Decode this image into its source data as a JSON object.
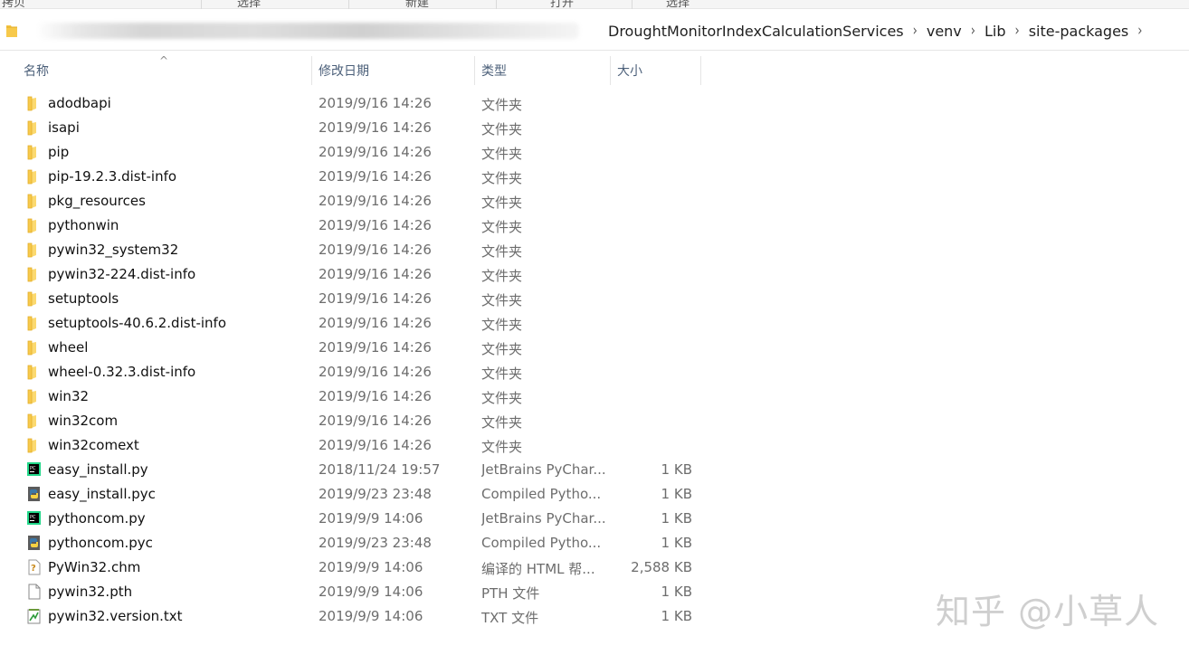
{
  "ribbon": {
    "labels": [
      "拷贝",
      "选择",
      "新建",
      "打开",
      "选择"
    ]
  },
  "address": {
    "crumbs": [
      "DroughtMonitorIndexCalculationServices",
      "venv",
      "Lib",
      "site-packages"
    ]
  },
  "columns": {
    "name": "名称",
    "date": "修改日期",
    "type": "类型",
    "size": "大小",
    "sort_indicator": "^"
  },
  "files": [
    {
      "icon": "folder-icon",
      "name": "adodbapi",
      "date": "2019/9/16 14:26",
      "type": "文件夹",
      "size": ""
    },
    {
      "icon": "folder-icon",
      "name": "isapi",
      "date": "2019/9/16 14:26",
      "type": "文件夹",
      "size": ""
    },
    {
      "icon": "folder-icon",
      "name": "pip",
      "date": "2019/9/16 14:26",
      "type": "文件夹",
      "size": ""
    },
    {
      "icon": "folder-icon",
      "name": "pip-19.2.3.dist-info",
      "date": "2019/9/16 14:26",
      "type": "文件夹",
      "size": ""
    },
    {
      "icon": "folder-icon",
      "name": "pkg_resources",
      "date": "2019/9/16 14:26",
      "type": "文件夹",
      "size": ""
    },
    {
      "icon": "folder-icon",
      "name": "pythonwin",
      "date": "2019/9/16 14:26",
      "type": "文件夹",
      "size": ""
    },
    {
      "icon": "folder-icon",
      "name": "pywin32_system32",
      "date": "2019/9/16 14:26",
      "type": "文件夹",
      "size": ""
    },
    {
      "icon": "folder-icon",
      "name": "pywin32-224.dist-info",
      "date": "2019/9/16 14:26",
      "type": "文件夹",
      "size": ""
    },
    {
      "icon": "folder-icon",
      "name": "setuptools",
      "date": "2019/9/16 14:26",
      "type": "文件夹",
      "size": ""
    },
    {
      "icon": "folder-icon",
      "name": "setuptools-40.6.2.dist-info",
      "date": "2019/9/16 14:26",
      "type": "文件夹",
      "size": ""
    },
    {
      "icon": "folder-icon",
      "name": "wheel",
      "date": "2019/9/16 14:26",
      "type": "文件夹",
      "size": ""
    },
    {
      "icon": "folder-icon",
      "name": "wheel-0.32.3.dist-info",
      "date": "2019/9/16 14:26",
      "type": "文件夹",
      "size": ""
    },
    {
      "icon": "folder-icon",
      "name": "win32",
      "date": "2019/9/16 14:26",
      "type": "文件夹",
      "size": ""
    },
    {
      "icon": "folder-icon",
      "name": "win32com",
      "date": "2019/9/16 14:26",
      "type": "文件夹",
      "size": ""
    },
    {
      "icon": "folder-icon",
      "name": "win32comext",
      "date": "2019/9/16 14:26",
      "type": "文件夹",
      "size": ""
    },
    {
      "icon": "pycharm-file-icon",
      "name": "easy_install.py",
      "date": "2018/11/24 19:57",
      "type": "JetBrains PyChar...",
      "size": "1 KB"
    },
    {
      "icon": "python-compiled-icon",
      "name": "easy_install.pyc",
      "date": "2019/9/23 23:48",
      "type": "Compiled Pytho...",
      "size": "1 KB"
    },
    {
      "icon": "pycharm-file-icon",
      "name": "pythoncom.py",
      "date": "2019/9/9 14:06",
      "type": "JetBrains PyChar...",
      "size": "1 KB"
    },
    {
      "icon": "python-compiled-icon",
      "name": "pythoncom.pyc",
      "date": "2019/9/23 23:48",
      "type": "Compiled Pytho...",
      "size": "1 KB"
    },
    {
      "icon": "chm-help-icon",
      "name": "PyWin32.chm",
      "date": "2019/9/9 14:06",
      "type": "编译的 HTML 帮...",
      "size": "2,588 KB"
    },
    {
      "icon": "blank-file-icon",
      "name": "pywin32.pth",
      "date": "2019/9/9 14:06",
      "type": "PTH 文件",
      "size": "1 KB"
    },
    {
      "icon": "text-file-icon",
      "name": "pywin32.version.txt",
      "date": "2019/9/9 14:06",
      "type": "TXT 文件",
      "size": "1 KB"
    }
  ],
  "watermark": "知乎 @小草人",
  "colors": {
    "folder": "#f7c94b",
    "header_text": "#4c607a",
    "meta_text": "#6d6d6d"
  }
}
